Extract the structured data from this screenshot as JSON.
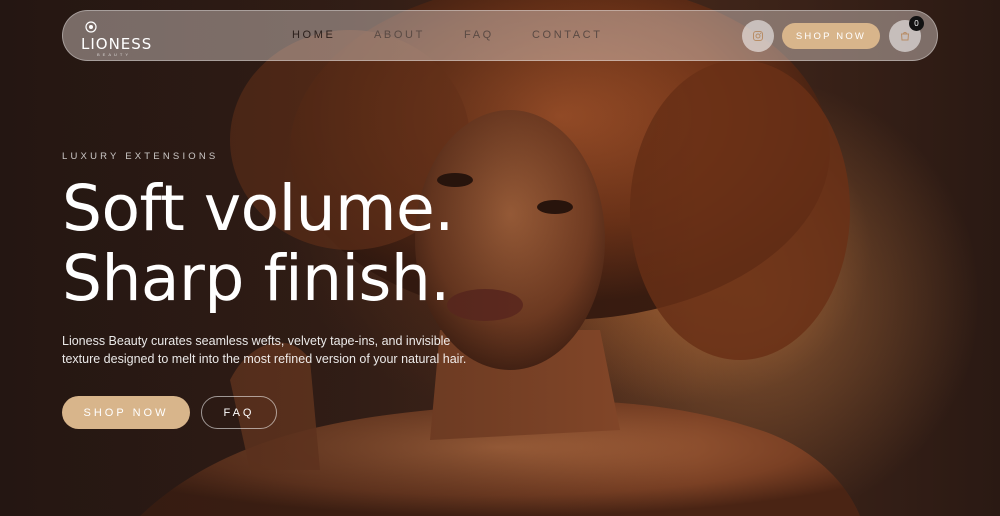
{
  "brand": {
    "name": "LIONESS",
    "tagline": "BEAUTY"
  },
  "nav": {
    "links": [
      {
        "label": "HOME",
        "active": true
      },
      {
        "label": "ABOUT",
        "active": false
      },
      {
        "label": "FAQ",
        "active": false
      },
      {
        "label": "CONTACT",
        "active": false
      }
    ],
    "shop_label": "SHOP NOW",
    "cart_count": "0",
    "icons": [
      "instagram-icon",
      "cart-icon"
    ]
  },
  "hero": {
    "eyebrow": "LUXURY EXTENSIONS",
    "headline_line1": "Soft volume.",
    "headline_line2": "Sharp finish.",
    "description": "Lioness Beauty curates seamless wefts, velvety tape-ins, and invisible texture designed to melt into the most refined version of your natural hair.",
    "primary_cta": "SHOP NOW",
    "secondary_cta": "FAQ"
  },
  "colors": {
    "accent": "#d8b58b",
    "background": "#2a1a14",
    "text": "#ffffff"
  }
}
